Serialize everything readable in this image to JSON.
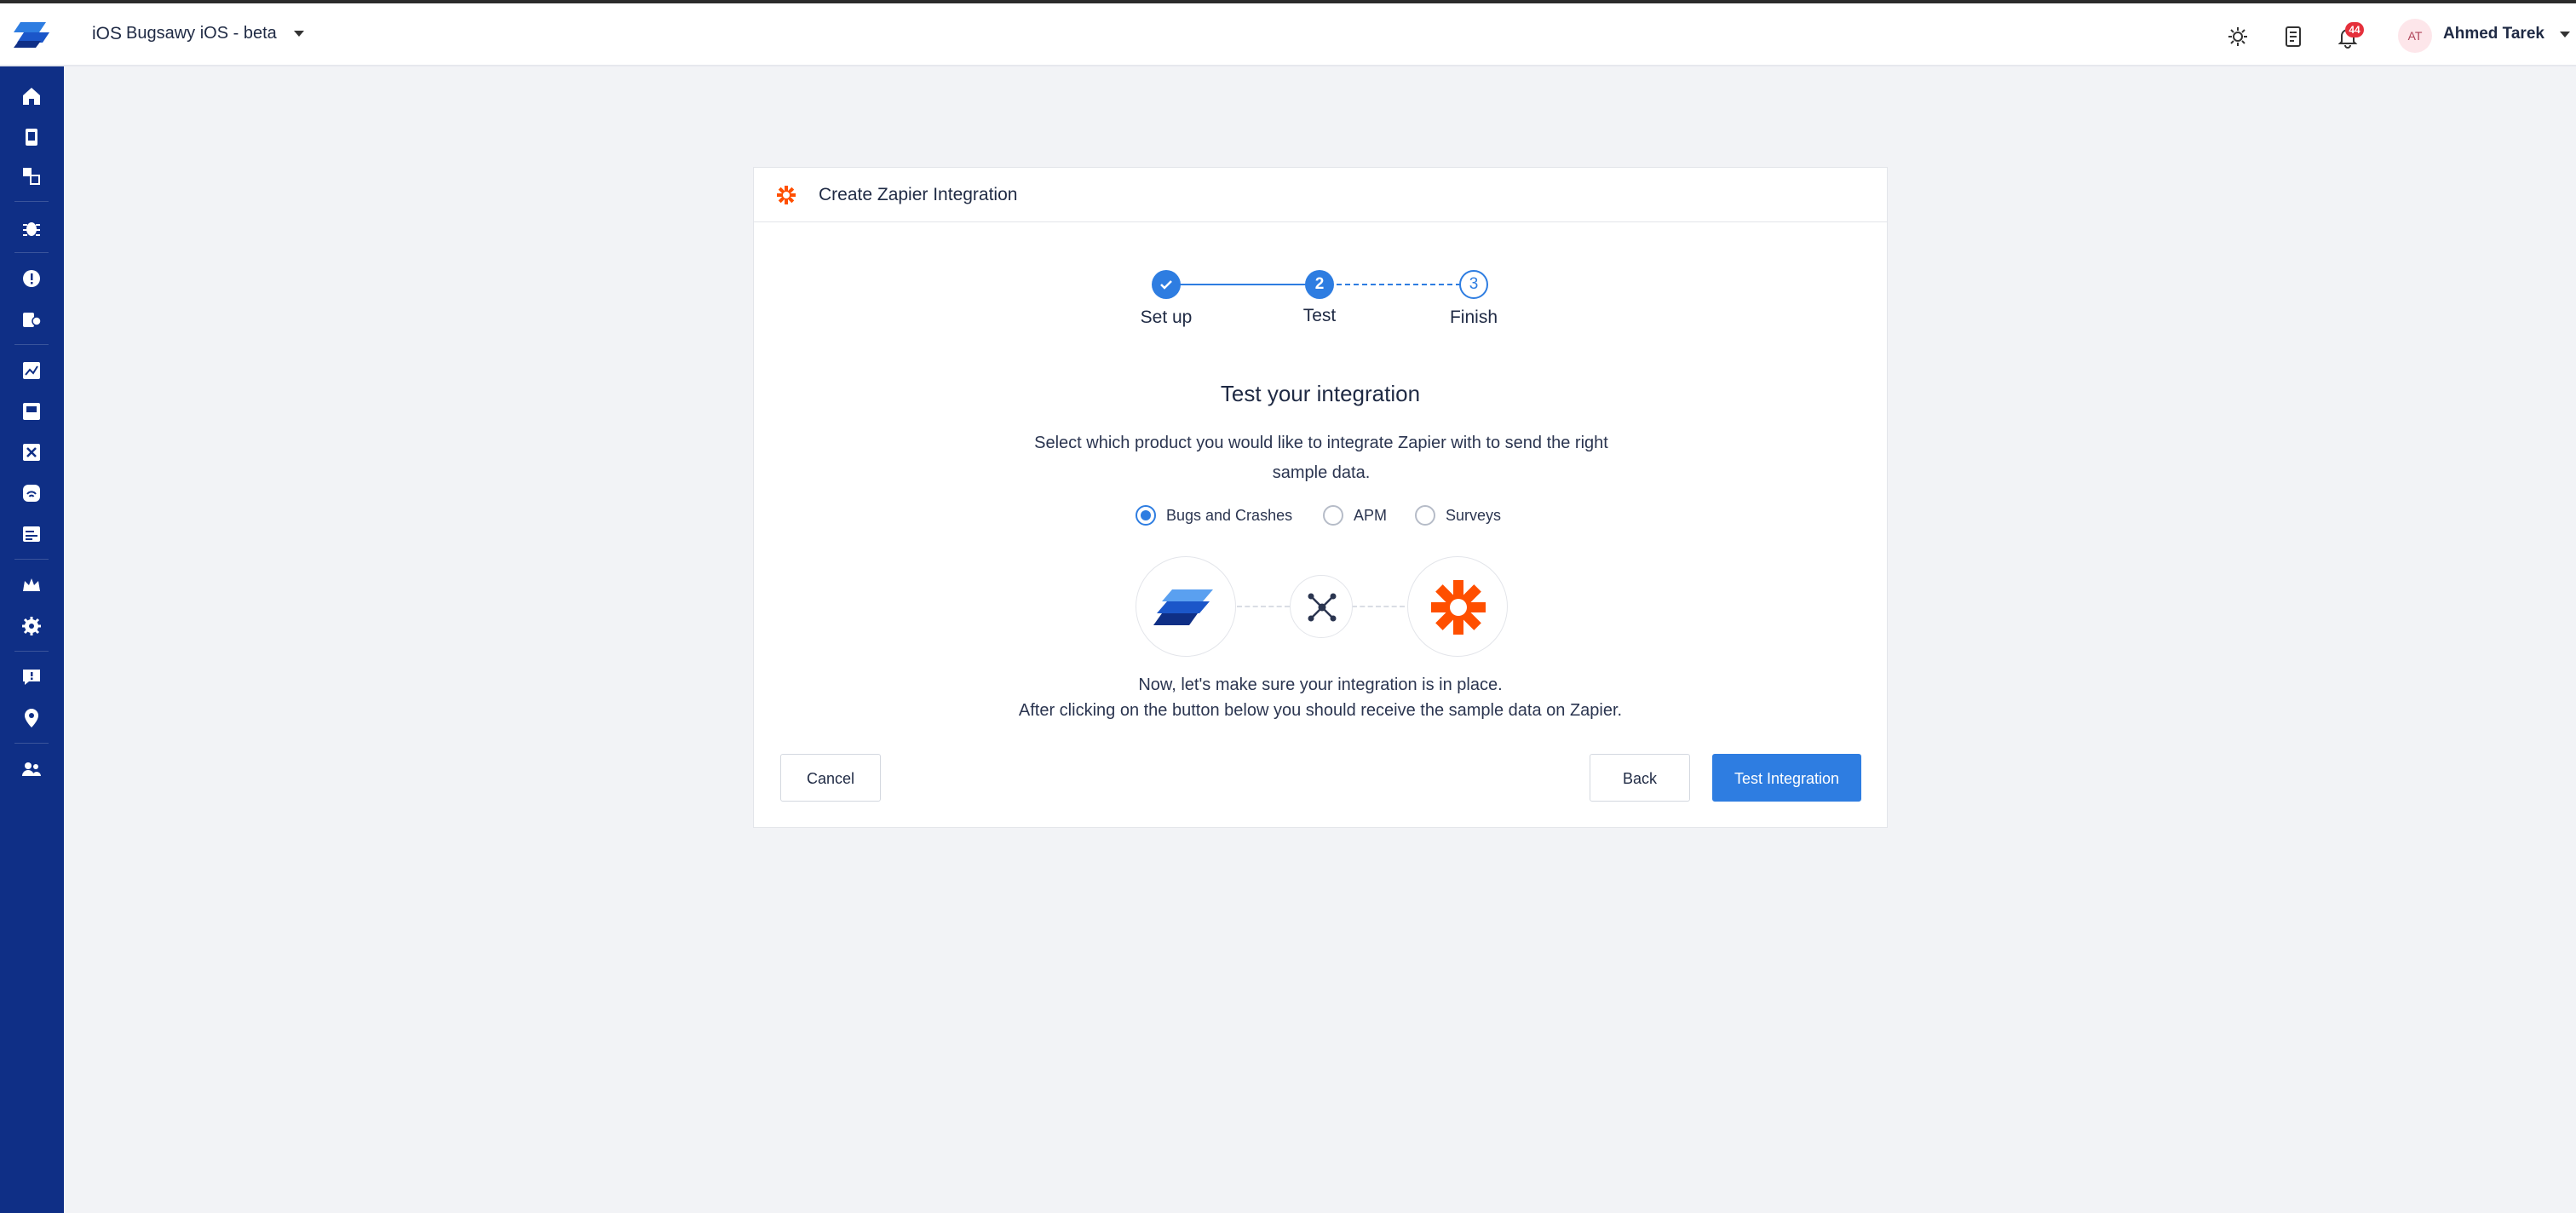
{
  "header": {
    "platform": "iOS",
    "app_name": "Bugsawy iOS - beta",
    "notification_count": "44",
    "user_initials": "AT",
    "user_name": "Ahmed Tarek"
  },
  "sidebar": {
    "icons": [
      "home-icon",
      "devices-icon",
      "builds-icon",
      "bug-icon",
      "crash-icon",
      "user-issue-icon",
      "apm-icon",
      "screen-icon",
      "flows-icon",
      "network-icon",
      "reports-icon",
      "crown-icon",
      "settings-icon",
      "feedback-icon",
      "location-icon",
      "team-icon"
    ]
  },
  "modal": {
    "title": "Create Zapier Integration",
    "steps": [
      {
        "number": "1",
        "label": "Set up",
        "state": "done"
      },
      {
        "number": "2",
        "label": "Test",
        "state": "active"
      },
      {
        "number": "3",
        "label": "Finish",
        "state": "pending"
      }
    ],
    "heading": "Test your integration",
    "description": "Select which product you would like to integrate Zapier with to send the right sample data.",
    "products": [
      {
        "label": "Bugs and Crashes",
        "selected": true
      },
      {
        "label": "APM",
        "selected": false
      },
      {
        "label": "Surveys",
        "selected": false
      }
    ],
    "note_line1": "Now, let's make sure your integration is in place.",
    "note_line2": "After clicking on the button below you should receive the sample data on Zapier.",
    "cancel_label": "Cancel",
    "back_label": "Back",
    "test_label": "Test Integration"
  },
  "colors": {
    "sidebar": "#0f2f86",
    "primary": "#2e7de1",
    "zapier": "#ff4f00",
    "badge": "#e5303b"
  }
}
